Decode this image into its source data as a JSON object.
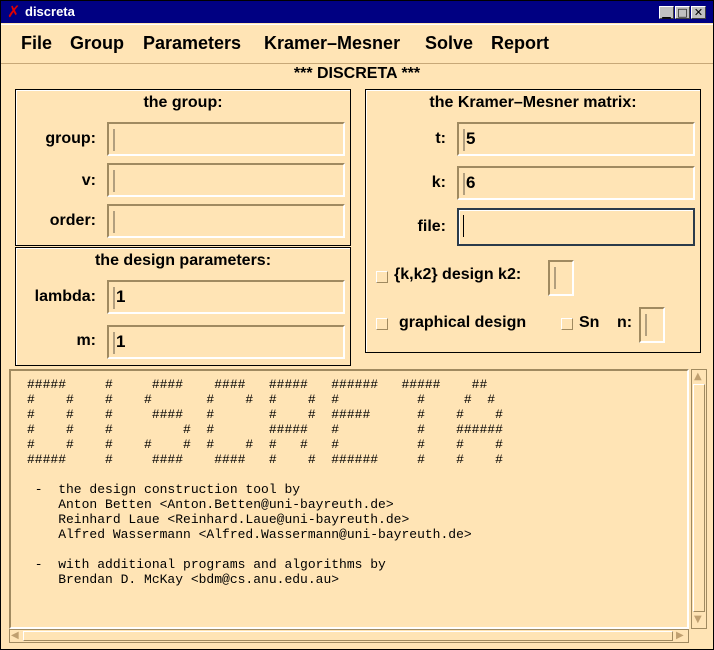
{
  "window": {
    "title": "discreta",
    "minimize": "▁",
    "maximize": "□",
    "close": "✕"
  },
  "menu": [
    "File",
    "Group",
    "Parameters",
    "Kramer–Mesner",
    "Solve",
    "Report"
  ],
  "app_title": "*** DISCRETA ***",
  "group_frame": {
    "title": "the group:",
    "group_label": "group:",
    "group_value": "",
    "v_label": "v:",
    "v_value": "",
    "order_label": "order:",
    "order_value": ""
  },
  "design_frame": {
    "title": "the design parameters:",
    "lambda_label": "lambda:",
    "lambda_value": "1",
    "m_label": "m:",
    "m_value": "1"
  },
  "km_frame": {
    "title": "the Kramer–Mesner matrix:",
    "t_label": "t:",
    "t_value": "5",
    "k_label": "k:",
    "k_value": "6",
    "file_label": "file:",
    "file_value": "",
    "k2_check_label": "{k,k2} design k2:",
    "k2_value": "",
    "graphical_label": "graphical design",
    "sn_label": "Sn",
    "n_label": "n:",
    "n_value": ""
  },
  "text_output": "#####     #     ####    ####   #####   ######   #####    ##\n#    #    #    #       #    #  #    #  #          #     #  #\n#    #    #     ####   #       #    #  #####      #    #    #\n#    #    #         #  #       #####   #          #    ######\n#    #    #    #    #  #    #  #   #   #          #    #    #\n#####     #     ####    ####   #    #  ######     #    #    #\n\n -  the design construction tool by\n    Anton Betten <Anton.Betten@uni-bayreuth.de>\n    Reinhard Laue <Reinhard.Laue@uni-bayreuth.de>\n    Alfred Wassermann <Alfred.Wassermann@uni-bayreuth.de>\n\n -  with additional programs and algorithms by\n    Brendan D. McKay <bdm@cs.anu.edu.au>",
  "colors": {
    "background": "#ffe4b5",
    "titlebar": "#000082",
    "focus_border": "#2b3b4b"
  }
}
